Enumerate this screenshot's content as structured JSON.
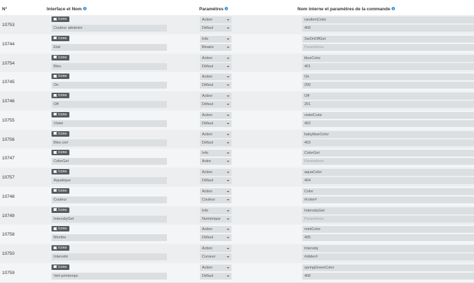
{
  "headers": {
    "num": "N°",
    "interface": "Interface et Nom",
    "params": "Paramètres",
    "command": "Nom interne et paramètres de la commande"
  },
  "icon_label": "Icone",
  "rows": [
    {
      "id": "10753",
      "name": "Couleur aléatoire",
      "type": "Action",
      "subtype": "Défaut",
      "logical": "randomColor",
      "param": "400",
      "param_placeholder": false
    },
    {
      "id": "10744",
      "name": "Etat",
      "type": "Info",
      "subtype": "Binaire",
      "logical": "SwOnOffGet",
      "param": "Paramètres",
      "param_placeholder": true
    },
    {
      "id": "10754",
      "name": "Bleu",
      "type": "Action",
      "subtype": "Défaut",
      "logical": "blueColor",
      "param": "401",
      "param_placeholder": false
    },
    {
      "id": "10745",
      "name": "On",
      "type": "Action",
      "subtype": "Défaut",
      "logical": "On",
      "param": "200",
      "param_placeholder": false
    },
    {
      "id": "10746",
      "name": "Off",
      "type": "Action",
      "subtype": "Défaut",
      "logical": "Off",
      "param": "201",
      "param_placeholder": false
    },
    {
      "id": "10755",
      "name": "Violet",
      "type": "Action",
      "subtype": "Défaut",
      "logical": "violetColor",
      "param": "402",
      "param_placeholder": false
    },
    {
      "id": "10756",
      "name": "Bleu ciel",
      "type": "Action",
      "subtype": "Défaut",
      "logical": "babyblueColor",
      "param": "403",
      "param_placeholder": false
    },
    {
      "id": "10747",
      "name": "ColorGet",
      "type": "Info",
      "subtype": "Autre",
      "logical": "ColorGet",
      "param": "Paramètres",
      "param_placeholder": true
    },
    {
      "id": "10757",
      "name": "Aquatique",
      "type": "Action",
      "subtype": "Défaut",
      "logical": "aquaColor",
      "param": "404",
      "param_placeholder": false
    },
    {
      "id": "10748",
      "name": "Couleur",
      "type": "Action",
      "subtype": "Couleur",
      "logical": "Color",
      "param": "#color#",
      "param_placeholder": false
    },
    {
      "id": "10749",
      "name": "IntensityGet",
      "type": "Info",
      "subtype": "Numérique",
      "logical": "IntensityGet",
      "param": "Paramètres",
      "param_placeholder": true
    },
    {
      "id": "10758",
      "name": "Menthe",
      "type": "Action",
      "subtype": "Défaut",
      "logical": "mintColor",
      "param": "405",
      "param_placeholder": false
    },
    {
      "id": "10750",
      "name": "Intensité",
      "type": "Action",
      "subtype": "Curseur",
      "logical": "Intensity",
      "param": "#slider#",
      "param_placeholder": false
    },
    {
      "id": "10759",
      "name": "Vert printemps",
      "type": "Action",
      "subtype": "Défaut",
      "logical": "springGreenColor",
      "param": "406",
      "param_placeholder": false
    }
  ]
}
